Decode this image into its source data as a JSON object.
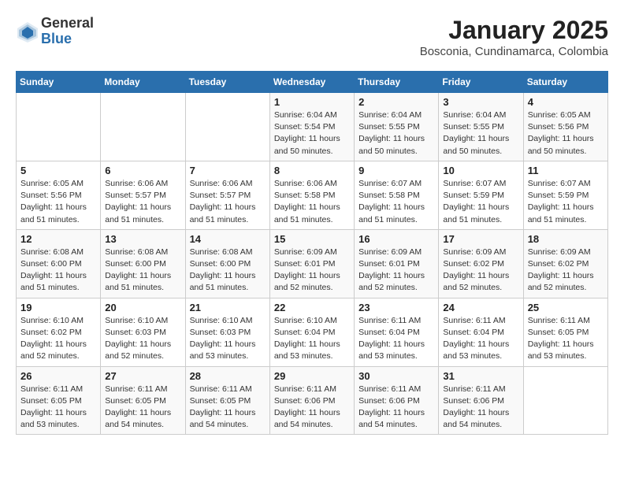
{
  "header": {
    "logo_general": "General",
    "logo_blue": "Blue",
    "title": "January 2025",
    "subtitle": "Bosconia, Cundinamarca, Colombia"
  },
  "days_of_week": [
    "Sunday",
    "Monday",
    "Tuesday",
    "Wednesday",
    "Thursday",
    "Friday",
    "Saturday"
  ],
  "weeks": [
    {
      "days": [
        {
          "num": "",
          "info": ""
        },
        {
          "num": "",
          "info": ""
        },
        {
          "num": "",
          "info": ""
        },
        {
          "num": "1",
          "info": "Sunrise: 6:04 AM\nSunset: 5:54 PM\nDaylight: 11 hours and 50 minutes."
        },
        {
          "num": "2",
          "info": "Sunrise: 6:04 AM\nSunset: 5:55 PM\nDaylight: 11 hours and 50 minutes."
        },
        {
          "num": "3",
          "info": "Sunrise: 6:04 AM\nSunset: 5:55 PM\nDaylight: 11 hours and 50 minutes."
        },
        {
          "num": "4",
          "info": "Sunrise: 6:05 AM\nSunset: 5:56 PM\nDaylight: 11 hours and 50 minutes."
        }
      ]
    },
    {
      "days": [
        {
          "num": "5",
          "info": "Sunrise: 6:05 AM\nSunset: 5:56 PM\nDaylight: 11 hours and 51 minutes."
        },
        {
          "num": "6",
          "info": "Sunrise: 6:06 AM\nSunset: 5:57 PM\nDaylight: 11 hours and 51 minutes."
        },
        {
          "num": "7",
          "info": "Sunrise: 6:06 AM\nSunset: 5:57 PM\nDaylight: 11 hours and 51 minutes."
        },
        {
          "num": "8",
          "info": "Sunrise: 6:06 AM\nSunset: 5:58 PM\nDaylight: 11 hours and 51 minutes."
        },
        {
          "num": "9",
          "info": "Sunrise: 6:07 AM\nSunset: 5:58 PM\nDaylight: 11 hours and 51 minutes."
        },
        {
          "num": "10",
          "info": "Sunrise: 6:07 AM\nSunset: 5:59 PM\nDaylight: 11 hours and 51 minutes."
        },
        {
          "num": "11",
          "info": "Sunrise: 6:07 AM\nSunset: 5:59 PM\nDaylight: 11 hours and 51 minutes."
        }
      ]
    },
    {
      "days": [
        {
          "num": "12",
          "info": "Sunrise: 6:08 AM\nSunset: 6:00 PM\nDaylight: 11 hours and 51 minutes."
        },
        {
          "num": "13",
          "info": "Sunrise: 6:08 AM\nSunset: 6:00 PM\nDaylight: 11 hours and 51 minutes."
        },
        {
          "num": "14",
          "info": "Sunrise: 6:08 AM\nSunset: 6:00 PM\nDaylight: 11 hours and 51 minutes."
        },
        {
          "num": "15",
          "info": "Sunrise: 6:09 AM\nSunset: 6:01 PM\nDaylight: 11 hours and 52 minutes."
        },
        {
          "num": "16",
          "info": "Sunrise: 6:09 AM\nSunset: 6:01 PM\nDaylight: 11 hours and 52 minutes."
        },
        {
          "num": "17",
          "info": "Sunrise: 6:09 AM\nSunset: 6:02 PM\nDaylight: 11 hours and 52 minutes."
        },
        {
          "num": "18",
          "info": "Sunrise: 6:09 AM\nSunset: 6:02 PM\nDaylight: 11 hours and 52 minutes."
        }
      ]
    },
    {
      "days": [
        {
          "num": "19",
          "info": "Sunrise: 6:10 AM\nSunset: 6:02 PM\nDaylight: 11 hours and 52 minutes."
        },
        {
          "num": "20",
          "info": "Sunrise: 6:10 AM\nSunset: 6:03 PM\nDaylight: 11 hours and 52 minutes."
        },
        {
          "num": "21",
          "info": "Sunrise: 6:10 AM\nSunset: 6:03 PM\nDaylight: 11 hours and 53 minutes."
        },
        {
          "num": "22",
          "info": "Sunrise: 6:10 AM\nSunset: 6:04 PM\nDaylight: 11 hours and 53 minutes."
        },
        {
          "num": "23",
          "info": "Sunrise: 6:11 AM\nSunset: 6:04 PM\nDaylight: 11 hours and 53 minutes."
        },
        {
          "num": "24",
          "info": "Sunrise: 6:11 AM\nSunset: 6:04 PM\nDaylight: 11 hours and 53 minutes."
        },
        {
          "num": "25",
          "info": "Sunrise: 6:11 AM\nSunset: 6:05 PM\nDaylight: 11 hours and 53 minutes."
        }
      ]
    },
    {
      "days": [
        {
          "num": "26",
          "info": "Sunrise: 6:11 AM\nSunset: 6:05 PM\nDaylight: 11 hours and 53 minutes."
        },
        {
          "num": "27",
          "info": "Sunrise: 6:11 AM\nSunset: 6:05 PM\nDaylight: 11 hours and 54 minutes."
        },
        {
          "num": "28",
          "info": "Sunrise: 6:11 AM\nSunset: 6:05 PM\nDaylight: 11 hours and 54 minutes."
        },
        {
          "num": "29",
          "info": "Sunrise: 6:11 AM\nSunset: 6:06 PM\nDaylight: 11 hours and 54 minutes."
        },
        {
          "num": "30",
          "info": "Sunrise: 6:11 AM\nSunset: 6:06 PM\nDaylight: 11 hours and 54 minutes."
        },
        {
          "num": "31",
          "info": "Sunrise: 6:11 AM\nSunset: 6:06 PM\nDaylight: 11 hours and 54 minutes."
        },
        {
          "num": "",
          "info": ""
        }
      ]
    }
  ]
}
